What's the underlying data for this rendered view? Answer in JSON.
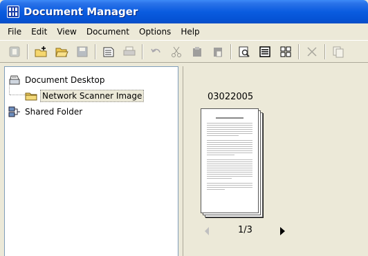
{
  "window": {
    "title": "Document Manager"
  },
  "menu": [
    "File",
    "Edit",
    "View",
    "Document",
    "Options",
    "Help"
  ],
  "toolbar": {
    "buttons": [
      {
        "icon": "properties-icon",
        "enabled": false
      },
      {
        "icon": "new-folder-icon",
        "enabled": true
      },
      {
        "icon": "open-folder-icon",
        "enabled": true
      },
      {
        "icon": "save-icon",
        "enabled": false
      },
      {
        "icon": "scan-icon",
        "enabled": true
      },
      {
        "icon": "print-icon",
        "enabled": false
      },
      {
        "icon": "undo-icon",
        "enabled": false
      },
      {
        "icon": "cut-icon",
        "enabled": false
      },
      {
        "icon": "copy-icon",
        "enabled": false
      },
      {
        "icon": "paste-icon",
        "enabled": false
      },
      {
        "icon": "zoom-icon",
        "enabled": true
      },
      {
        "icon": "list-view-icon",
        "enabled": true
      },
      {
        "icon": "thumbnail-view-icon",
        "enabled": true
      },
      {
        "icon": "delete-icon",
        "enabled": false
      },
      {
        "icon": "copy-pages-icon",
        "enabled": false
      }
    ]
  },
  "tree": {
    "items": [
      {
        "label": "Document Desktop",
        "icon": "desktop-tray-icon"
      },
      {
        "label": "Network Scanner Image",
        "icon": "folder-icon",
        "selected": true
      },
      {
        "label": "Shared Folder",
        "icon": "network-share-icon"
      }
    ]
  },
  "document": {
    "name": "03022005",
    "page_indicator": "1/3"
  },
  "colors": {
    "titlebar": "#0a5ce0",
    "window_bg": "#ece9d8",
    "tree_bg": "#ffffff"
  }
}
